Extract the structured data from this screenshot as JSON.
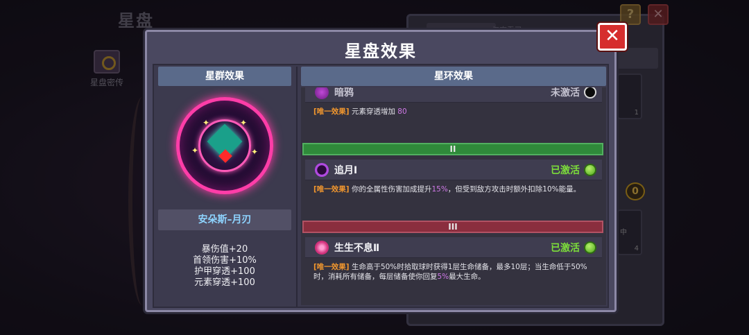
{
  "background": {
    "screen_title": "星盘",
    "lore_button_label": "星盘密传",
    "filter_tab_text": "仅查看已",
    "slot_counts": [
      "1",
      "4"
    ],
    "slot_partial_label": "中",
    "coin_label": "0",
    "help_button_label": "?",
    "close_button_label": "✕"
  },
  "modal": {
    "title": "星盘效果",
    "close_label": "✕",
    "left": {
      "header": "星群效果",
      "character_name": "安朵斯–月刃",
      "stats": [
        "暴伤值+20",
        "首领伤害+10%",
        "护甲穿透+100",
        "元素穿透+100"
      ]
    },
    "right": {
      "header": "星环效果",
      "effects": [
        {
          "name": "暗鸦",
          "status": "未激活",
          "active": false,
          "icon": "crow-icon",
          "tag": "[唯一效果]",
          "desc_pre": " 元素穿透增加 ",
          "desc_hl": "80",
          "desc_post": ""
        },
        {
          "tier": "II",
          "name": "追月Ⅰ",
          "status": "已激活",
          "active": true,
          "icon": "crescent-moon-icon",
          "tag": "[唯一效果]",
          "desc_pre": " 你的全属性伤害加成提升",
          "desc_hl": "15%",
          "desc_post": "，但受到敌方攻击时额外扣除10%能量。"
        },
        {
          "tier": "III",
          "name": "生生不息Ⅱ",
          "status": "已激活",
          "active": true,
          "icon": "flower-icon",
          "tag": "[唯一效果]",
          "desc_pre": " 生命高于50%时拾取球时获得1层生命储备，最多10层；当生命低于50%时，消耗所有储备，每层储备使你回复",
          "desc_hl": "5%",
          "desc_post": "最大生命。"
        }
      ]
    }
  },
  "colors": {
    "active_green": "#7dde3a",
    "tag_orange": "#f0962e",
    "highlight_purple": "#d07ae8",
    "tier2_green": "#2f8a3a",
    "tier3_red": "#8a2e3e",
    "close_red": "#d62e2e"
  }
}
